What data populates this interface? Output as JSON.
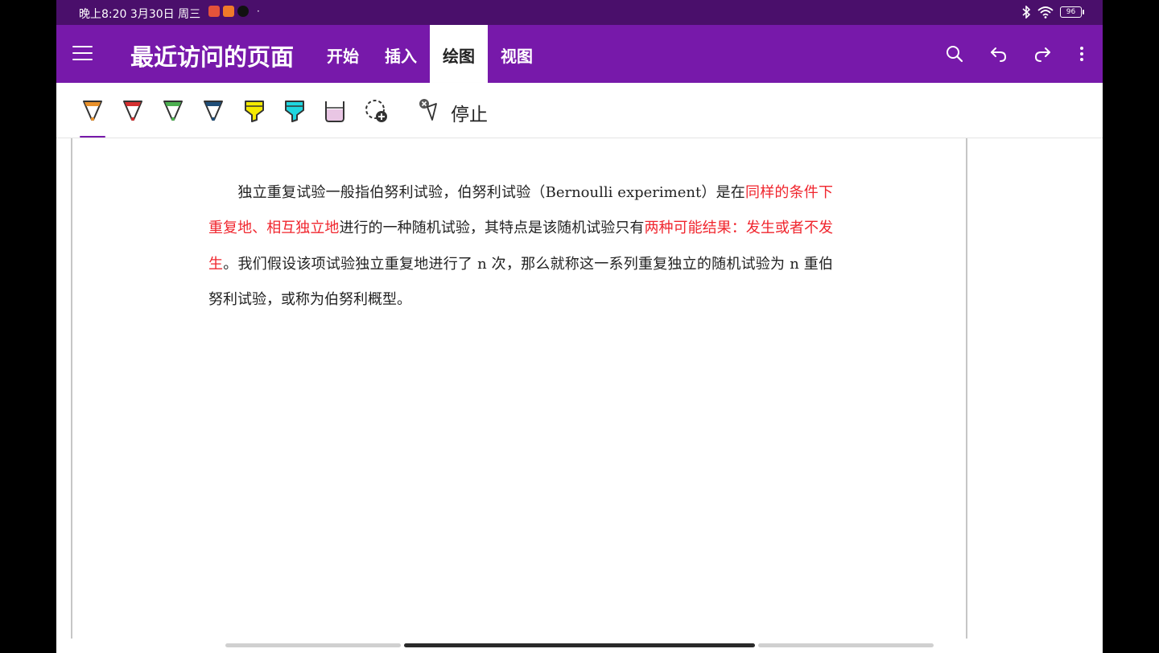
{
  "status_bar": {
    "time": "晚上8:20",
    "date": "3月30日 周三",
    "dot": "·",
    "battery": "96",
    "apps": [
      {
        "name": "app-1",
        "color": "#e5533a"
      },
      {
        "name": "app-2",
        "color": "#f07a2a"
      },
      {
        "name": "tiktok",
        "color": "#111111"
      }
    ]
  },
  "header": {
    "title": "最近访问的页面",
    "tabs": [
      {
        "label": "开始",
        "active": false
      },
      {
        "label": "插入",
        "active": false
      },
      {
        "label": "绘图",
        "active": true
      },
      {
        "label": "视图",
        "active": false
      }
    ],
    "icons": [
      "menu-icon",
      "search-icon",
      "undo-icon",
      "redo-icon",
      "more-icon"
    ]
  },
  "toolbar": {
    "pens": [
      {
        "name": "pen-orange",
        "color": "#e8902a",
        "selected": true
      },
      {
        "name": "pen-red",
        "color": "#d32f2f",
        "selected": false
      },
      {
        "name": "pen-green",
        "color": "#4caf50",
        "selected": false
      },
      {
        "name": "pen-navy",
        "color": "#1f4e79",
        "selected": false
      },
      {
        "name": "highlighter-yellow",
        "color": "#f5e900",
        "selected": false
      },
      {
        "name": "highlighter-cyan",
        "color": "#1fd6e0",
        "selected": false
      },
      {
        "name": "highlighter-pink",
        "color": "#e9c6e4",
        "selected": false
      }
    ],
    "stop_label": "停止"
  },
  "content": {
    "indent": "　　",
    "segments": [
      {
        "text": "独立重复试验一般指伯努利试验，伯努利试验（Bernoulli experiment）是在",
        "red": false
      },
      {
        "text": "同样的条件下重复地、相互独立地",
        "red": true
      },
      {
        "text": "进行的一种随机试验，其特点是该随机试验只有",
        "red": false
      },
      {
        "text": "两种可能结果：发生或者不发生",
        "red": true
      },
      {
        "text": "。我们假设该项试验独立重复地进行了 n 次，那么就称这一系列重复独立的随机试验为 n 重伯努利试验，或称为伯努利概型。",
        "red": false
      }
    ]
  },
  "colors": {
    "accent": "#7719aa",
    "status_bar": "#4a0f6b",
    "highlight_text": "#f0262e"
  }
}
